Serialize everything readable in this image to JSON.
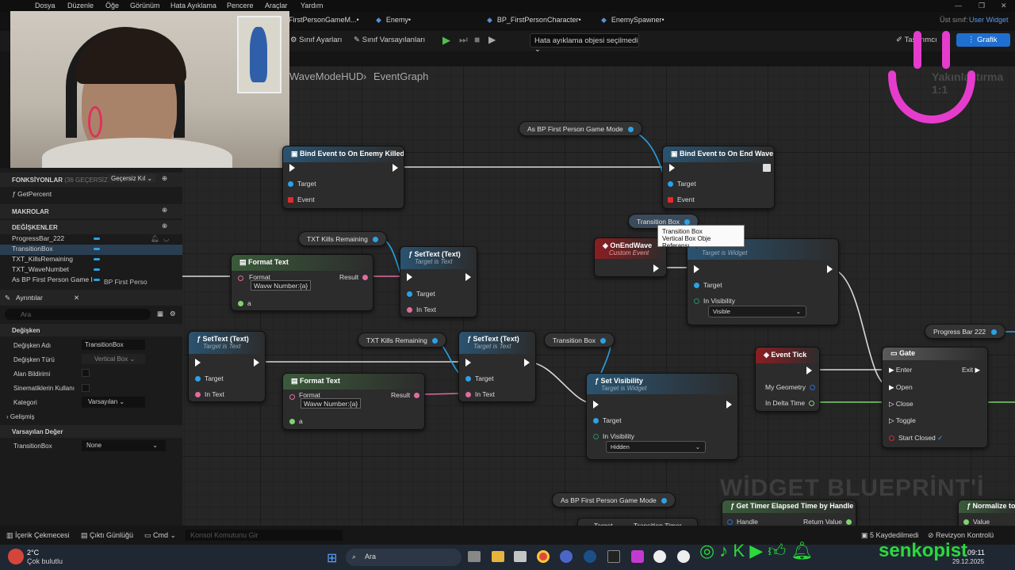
{
  "menu": {
    "items": [
      "Dosya",
      "Düzenle",
      "Öğe",
      "Görünüm",
      "Hata Ayıklama",
      "Pencere",
      "Araçlar",
      "Yardım"
    ],
    "parent_class_label": "Üst sınıf:",
    "parent_class": "User Widget"
  },
  "tabs": [
    "FirstPersonGameM...•",
    "Enemy•",
    "BP_FirstPersonCharacter•",
    "EnemySpawner•"
  ],
  "toolbar": {
    "class_settings": "Sınıf Ayarları",
    "class_defaults": "Sınıf Varsayılanları",
    "debug_select": "Hata ayıklama objesi seçilmedi",
    "graph_button": "Grafik",
    "designer_button": "Tasarımcı"
  },
  "breadcrumb": {
    "asset": "WaveModeHUD",
    "graph": "EventGraph",
    "zoom": "Yakınlaştırma 1:1"
  },
  "watermark": "WİDGET BLUEPRİNT'İ",
  "left_panel": {
    "functions_header": "FONKSİYONLAR",
    "functions_count": "(36 GEÇERSİZ KILIN",
    "override_label": "Geçersiz Kıl",
    "function_item": "GetPercent",
    "macros_header": "MAKROLAR",
    "variables_header": "DEĞİŞKENLER",
    "variables": [
      {
        "name": "ProgressBar_222",
        "type": ""
      },
      {
        "name": "TransitionBox",
        "type": ""
      },
      {
        "name": "TXT_KillsRemaining",
        "type": ""
      },
      {
        "name": "TXT_WaveNumbet",
        "type": ""
      },
      {
        "name": "As BP First Person Game I",
        "type": "BP First Perso"
      }
    ],
    "details_title": "Ayrıntılar",
    "search_placeholder": "Ara",
    "variable_section": "Değişken",
    "props": [
      {
        "label": "Değişken Adı",
        "value": "TransitionBox"
      },
      {
        "label": "Değişken Türü",
        "value": "Vertical Box"
      },
      {
        "label": "Alan Bildirimi",
        "value": ""
      },
      {
        "label": "Sinematiklerin Kullanı",
        "value": ""
      },
      {
        "label": "Kategori",
        "value": "Varsayılan"
      }
    ],
    "advanced": "Gelişmiş",
    "default_section": "Varsayılan Değer",
    "default_label": "TransitionBox",
    "default_value": "None"
  },
  "nodes": {
    "bind_enemy_killed": {
      "title": "Bind Event to On Enemy Killed",
      "target": "Target",
      "event": "Event"
    },
    "bind_end_wave": {
      "title": "Bind Event to On End Wave",
      "target": "Target",
      "event": "Event"
    },
    "as_bp_game_mode": "As BP First Person Game Mode",
    "as_bp_game_mode2": "As BP First Person Game Mode",
    "txt_kills": "TXT Kills Remaining",
    "txt_kills2": "TXT Kills Remaining",
    "transition_box": "Transition Box",
    "transition_box2": "Transition Box",
    "progress_bar": "Progress Bar 222",
    "tooltip_title": "Transition Box",
    "tooltip_sub": "Vertical Box Obje Referansı",
    "format_text1": {
      "title": "Format Text",
      "format": "Format",
      "format_value": "Wavw Number:{a}",
      "result": "Result",
      "a": "a"
    },
    "format_text2": {
      "title": "Format Text",
      "format": "Format",
      "format_value": "Wavw Number:{a}",
      "result": "Result",
      "a": "a"
    },
    "settext1": {
      "title": "SetText (Text)",
      "sub": "Target is Text",
      "target": "Target",
      "intext": "In Text"
    },
    "settext2": {
      "title": "SetText (Text)",
      "sub": "Target is Text",
      "target": "Target",
      "intext": "In Text"
    },
    "settext3": {
      "title": "SetText (Text)",
      "sub": "Target is Text",
      "target": "Target",
      "intext": "In Text"
    },
    "on_end_wave": {
      "title": "OnEndWave",
      "sub": "Custom Event"
    },
    "set_vis1": {
      "title": "Set Visibility",
      "sub": "Target is Widget",
      "target": "Target",
      "invis": "In Visibility",
      "value": "Visible"
    },
    "set_vis2": {
      "title": "Set Visibility",
      "sub": "Target is Widget",
      "target": "Target",
      "invis": "In Visibility",
      "value": "Hidden"
    },
    "event_tick": {
      "title": "Event Tick",
      "geom": "My Geometry",
      "delta": "In Delta Time"
    },
    "gate": {
      "title": "Gate",
      "enter": "Enter",
      "exit": "Exit",
      "open": "Open",
      "close": "Close",
      "toggle": "Toggle",
      "start_closed": "Start Closed"
    },
    "get_timer": {
      "title": "Get Timer Elapsed Time by Handle",
      "handle": "Handle",
      "ret": "Return Value"
    },
    "normalize": {
      "title": "Normalize to",
      "value": "Value"
    },
    "bottom_partial": {
      "target": "Target",
      "transition_timer": "Transition Timer"
    }
  },
  "statusbar": {
    "content_drawer": "İçerik Çekmecesi",
    "output_log": "Çıktı Günlüğü",
    "cmd": "Cmd",
    "console_placeholder": "Konsol Komutunu Gir",
    "saved": "5 Kaydedilmedi",
    "revision": "Revizyon Kontrolü"
  },
  "taskbar": {
    "temp": "2°C",
    "weather": "Çok bulutlu",
    "search": "Ara",
    "time": "09:11",
    "date": "29.12.2025",
    "brand": "senkopist"
  },
  "colors": {
    "accent": "#1f6fd1",
    "exec": "#ffffff",
    "object_pin": "#2aa2e8",
    "text_pin": "#e06c9f",
    "event_pin": "#e02b2b",
    "float_pin": "#7ed46e"
  }
}
